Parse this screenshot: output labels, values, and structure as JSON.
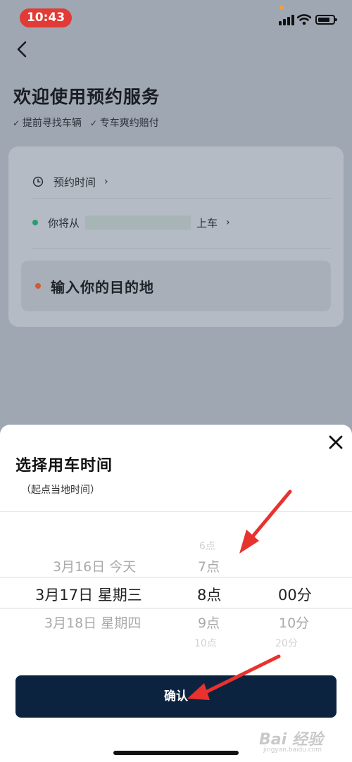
{
  "status_bar": {
    "time": "10:43",
    "icons": [
      "signal-icon",
      "wifi-icon",
      "battery-icon"
    ]
  },
  "header": {
    "back_icon": "chevron-left-icon",
    "title": "欢迎使用预约服务",
    "features": [
      "提前寻找车辆",
      "专车爽约赔付"
    ]
  },
  "booking": {
    "time_label": "预约时间",
    "pickup_prefix": "你将从",
    "pickup_suffix": "上车",
    "destination_placeholder": "输入你的目的地",
    "colors": {
      "pickup_dot": "#2a9a72",
      "destination_dot": "#d8582e"
    }
  },
  "time_sheet": {
    "title": "选择用车时间",
    "subtitle": "（起点当地时间）",
    "close_icon": "close-icon",
    "date_options": [
      "3月16日 今天",
      "3月17日 星期三",
      "3月18日 星期四"
    ],
    "selected_date": "3月17日 星期三",
    "hour_options": [
      "6点",
      "7点",
      "8点",
      "9点",
      "10点"
    ],
    "selected_hour": "8点",
    "minute_options": [
      "00分",
      "10分",
      "20分"
    ],
    "selected_minute": "00分",
    "confirm_label": "确认",
    "colors": {
      "confirm_bg": "#0c2340",
      "annotation_arrow": "#e8322e"
    }
  },
  "watermark": {
    "logo": "Bai 经验",
    "url": "jingyan.baidu.com"
  }
}
